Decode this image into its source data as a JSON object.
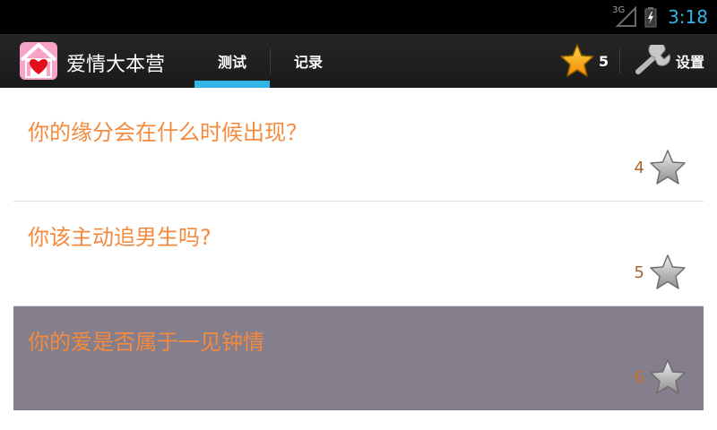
{
  "status_bar": {
    "network": "3G",
    "time": "3:18",
    "colors": {
      "clock": "#33b5e5"
    }
  },
  "action_bar": {
    "app_title": "爱情大本营",
    "app_icon": "heart-house-icon",
    "tabs": [
      {
        "label": "测试",
        "selected": true
      },
      {
        "label": "记录",
        "selected": false
      }
    ],
    "star_count": "5",
    "settings_label": "设置",
    "colors": {
      "tab_indicator": "#33b5e5"
    }
  },
  "list": {
    "items": [
      {
        "title": "你的缘分会在什么时候出现？",
        "count": "4",
        "icon": "star-icon",
        "selected": false
      },
      {
        "title": "你该主动追男生吗?",
        "count": "5",
        "icon": "star-icon",
        "selected": false
      },
      {
        "title": "你的爱是否属于一见钟情",
        "count": "6",
        "icon": "star-icon",
        "selected": true
      }
    ],
    "colors": {
      "title": "#f48a3e",
      "selected_bg": "#857e8d"
    }
  }
}
